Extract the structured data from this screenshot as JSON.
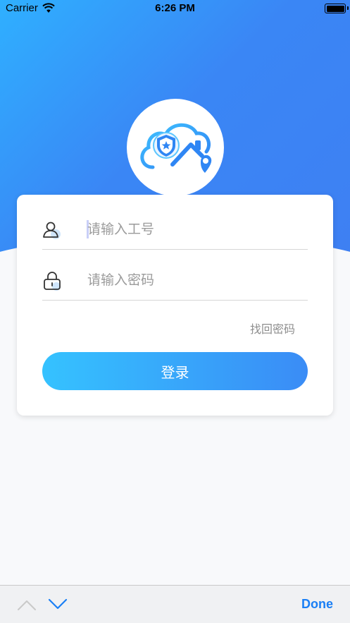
{
  "status_bar": {
    "carrier": "Carrier",
    "time": "6:26 PM"
  },
  "login": {
    "username_placeholder": "请输入工号",
    "password_placeholder": "请输入密码",
    "forgot_password": "找回密码",
    "login_button": "登录"
  },
  "keyboard_toolbar": {
    "done": "Done"
  },
  "icons": {
    "logo": "cloud-shield-map-pin-logo",
    "user": "user-icon",
    "lock": "lock-icon",
    "prev": "chevron-up-icon",
    "next": "chevron-down-icon"
  },
  "colors": {
    "brand_gradient_start": "#35c2ff",
    "brand_gradient_end": "#3a86f5",
    "done_blue": "#1a7ff5"
  }
}
